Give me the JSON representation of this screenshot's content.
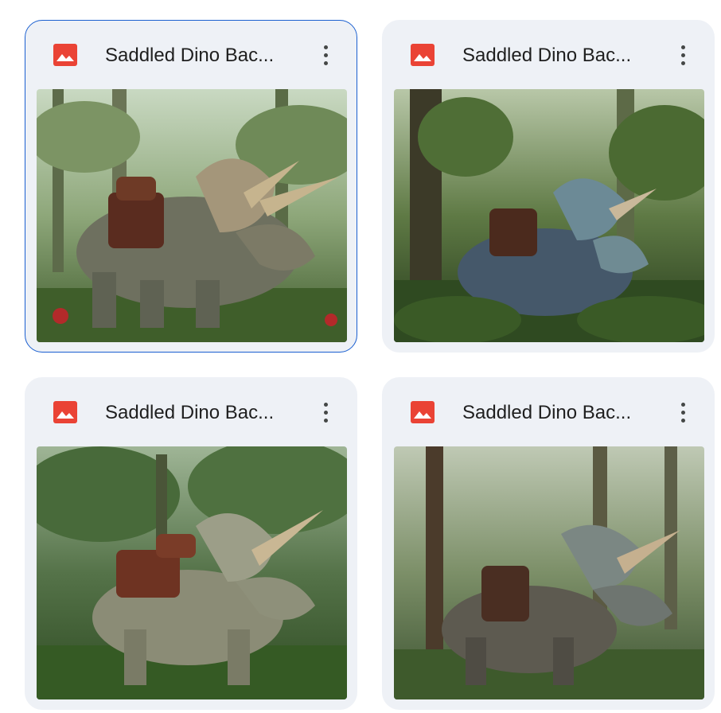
{
  "files": [
    {
      "name": "Saddled Dino Bac...",
      "selected": true
    },
    {
      "name": "Saddled Dino Bac...",
      "selected": false
    },
    {
      "name": "Saddled Dino Bac...",
      "selected": false
    },
    {
      "name": "Saddled Dino Bac...",
      "selected": false
    }
  ],
  "colors": {
    "card_bg": "#eef1f6",
    "selected_border": "#1a5fd0",
    "image_icon_red": "#ea4335",
    "text": "#1f1f1f"
  },
  "icons": {
    "file_type": "image-icon",
    "menu": "more-vert-icon"
  }
}
